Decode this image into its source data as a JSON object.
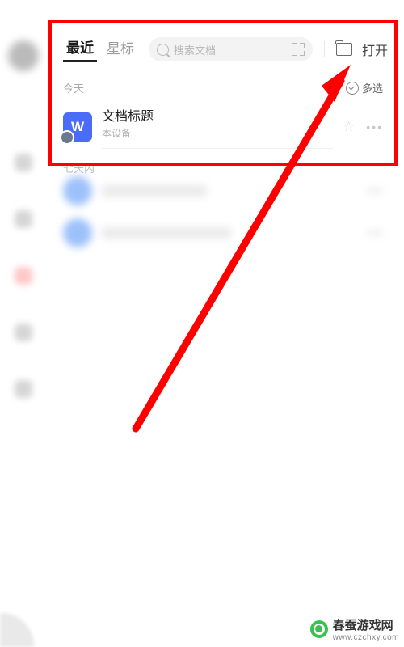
{
  "tabs": {
    "recent": "最近",
    "starred": "星标"
  },
  "search": {
    "placeholder": "搜索文档"
  },
  "open_label": "打开",
  "section": {
    "today": "今天",
    "week": "七天内",
    "multiselect": "多选"
  },
  "doc": {
    "title": "文档标题",
    "subtitle": "本设备",
    "icon_letter": "W"
  },
  "watermark": {
    "name": "春蚕游戏网",
    "url": "www.czchxy.com"
  }
}
